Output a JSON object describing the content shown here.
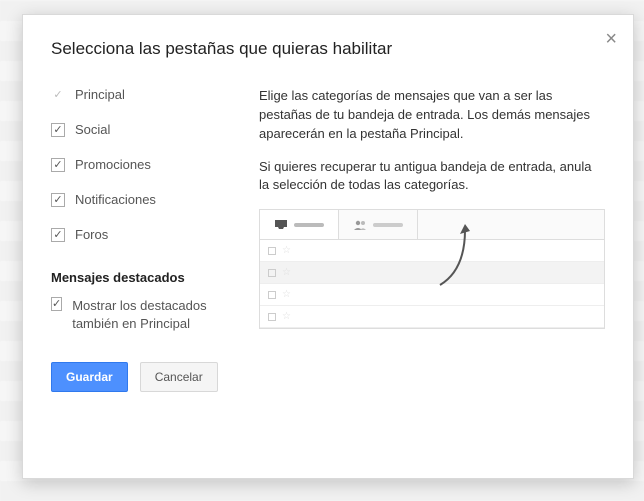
{
  "dialog": {
    "title": "Selecciona las pestañas que quieras habilitar",
    "close_glyph": "×"
  },
  "tabs": [
    {
      "label": "Principal",
      "checked": true,
      "locked": true
    },
    {
      "label": "Social",
      "checked": true,
      "locked": false
    },
    {
      "label": "Promociones",
      "checked": true,
      "locked": false
    },
    {
      "label": "Notificaciones",
      "checked": true,
      "locked": false
    },
    {
      "label": "Foros",
      "checked": true,
      "locked": false
    }
  ],
  "starred": {
    "header": "Mensajes destacados",
    "label": "Mostrar los destacados también en Principal",
    "checked": true
  },
  "description": {
    "p1": "Elige las categorías de mensajes que van a ser las pestañas de tu bandeja de entrada. Los demás mensajes aparecerán en la pestaña Principal.",
    "p2": "Si quieres recuperar tu antigua bandeja de entrada, anula la selección de todas las categorías."
  },
  "buttons": {
    "save": "Guardar",
    "cancel": "Cancelar"
  },
  "icons": {
    "check": "✓",
    "inbox": "◢",
    "people": "👥",
    "star": "☆"
  }
}
